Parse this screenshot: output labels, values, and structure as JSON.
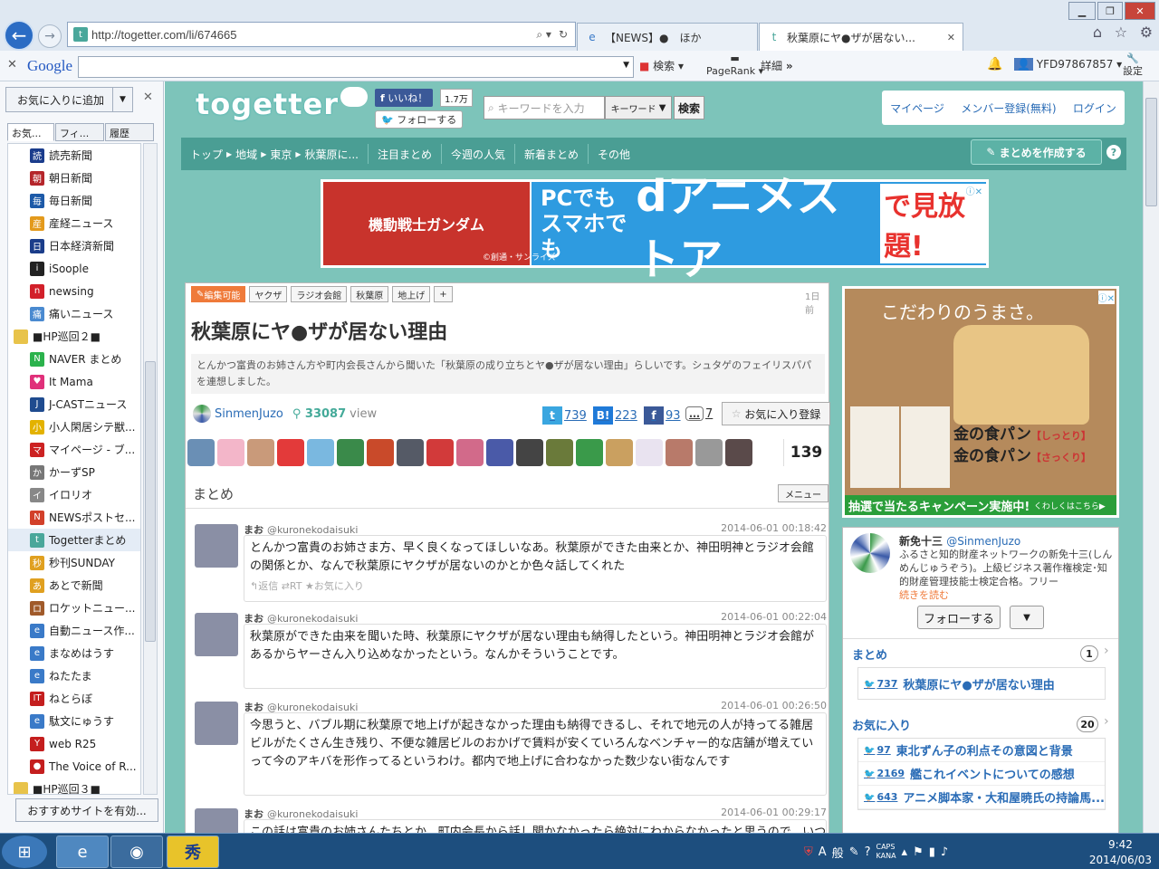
{
  "browser": {
    "url": "http://togetter.com/li/674665",
    "tabs": [
      {
        "label": "【NEWS】●　ほか",
        "active": false
      },
      {
        "label": "秋葉原にヤ●ザが居ない...",
        "active": true
      }
    ]
  },
  "google_bar": {
    "logo": "Google",
    "search": "検索",
    "pagerank": "PageRank",
    "detail": "詳細",
    "more": "»",
    "user": "YFD97867857",
    "settings": "設定"
  },
  "sidebar": {
    "add_favorite": "お気に入りに追加",
    "tabs": [
      "お気...",
      "フィ...",
      "履歴"
    ],
    "items": [
      {
        "label": "読売新聞",
        "color": "#1a3c8c",
        "glyph": "読",
        "type": "link"
      },
      {
        "label": "朝日新聞",
        "color": "#b5262b",
        "glyph": "朝",
        "type": "link"
      },
      {
        "label": "毎日新聞",
        "color": "#1d5aa8",
        "glyph": "毎",
        "type": "link"
      },
      {
        "label": "産経ニュース",
        "color": "#e39a1c",
        "glyph": "産",
        "type": "link"
      },
      {
        "label": "日本経済新聞",
        "color": "#1b3d8a",
        "glyph": "日",
        "type": "link"
      },
      {
        "label": "iSoople",
        "color": "#222222",
        "glyph": "i",
        "type": "link"
      },
      {
        "label": "newsing",
        "color": "#d2202a",
        "glyph": "n",
        "type": "link"
      },
      {
        "label": "痛いニュース",
        "color": "#4a8ad0",
        "glyph": "痛",
        "type": "link"
      },
      {
        "label": "■HP巡回２■",
        "color": "#e8c34a",
        "glyph": "",
        "type": "folder"
      },
      {
        "label": "NAVER まとめ",
        "color": "#2bb24c",
        "glyph": "N",
        "type": "link"
      },
      {
        "label": "It Mama",
        "color": "#e0307a",
        "glyph": "♥",
        "type": "link"
      },
      {
        "label": "J-CASTニュース",
        "color": "#1f4b8f",
        "glyph": "J",
        "type": "link"
      },
      {
        "label": "小人閑居シテ獣...",
        "color": "#e3b200",
        "glyph": "小",
        "type": "link"
      },
      {
        "label": "マイページ - ブ...",
        "color": "#cc2222",
        "glyph": "マ",
        "type": "link"
      },
      {
        "label": "かーずSP",
        "color": "#777777",
        "glyph": "か",
        "type": "link"
      },
      {
        "label": "イロリオ",
        "color": "#888888",
        "glyph": "イ",
        "type": "link"
      },
      {
        "label": "NEWSポストセ...",
        "color": "#d2402a",
        "glyph": "N",
        "type": "link"
      },
      {
        "label": "Togetterまとめ",
        "color": "#4aa79b",
        "glyph": "t",
        "type": "link",
        "selected": true
      },
      {
        "label": "秒刊SUNDAY",
        "color": "#e0a020",
        "glyph": "秒",
        "type": "link"
      },
      {
        "label": "あとで新聞",
        "color": "#e0a020",
        "glyph": "あ",
        "type": "link"
      },
      {
        "label": "ロケットニュー...",
        "color": "#a05a2a",
        "glyph": "ロ",
        "type": "link"
      },
      {
        "label": "自動ニュース作...",
        "color": "#3a7ac8",
        "glyph": "e",
        "type": "link"
      },
      {
        "label": "まなめはうす",
        "color": "#3a7ac8",
        "glyph": "e",
        "type": "link"
      },
      {
        "label": "ねたたま",
        "color": "#3a7ac8",
        "glyph": "e",
        "type": "link"
      },
      {
        "label": "ねとらぼ",
        "color": "#c41e1e",
        "glyph": "IT",
        "type": "link"
      },
      {
        "label": "駄文にゅうす",
        "color": "#3a7ac8",
        "glyph": "e",
        "type": "link"
      },
      {
        "label": "web R25",
        "color": "#c41e1e",
        "glyph": "Y",
        "type": "link"
      },
      {
        "label": "The Voice of R...",
        "color": "#c41e1e",
        "glyph": "●",
        "type": "link"
      },
      {
        "label": "■HP巡回３■",
        "color": "#e8c34a",
        "glyph": "",
        "type": "folder"
      }
    ],
    "recommend": "おすすめサイトを有効..."
  },
  "site": {
    "logo": "togetter",
    "fb_like": "いいね！",
    "fb_count": "1.7万",
    "follow": "フォローする",
    "search_placeholder": "キーワードを入力",
    "search_type": "キーワード",
    "search_btn": "検索",
    "account": [
      "マイページ",
      "メンバー登録(無料)",
      "ログイン"
    ],
    "nav": [
      "トップ",
      "▶",
      "地域",
      "▶",
      "東京",
      "▶",
      "秋葉原に...",
      "注目まとめ",
      "今週の人気",
      "新着まとめ",
      "その他"
    ],
    "create_btn": "まとめを作成する",
    "help": "?"
  },
  "banner": {
    "left": "機動戦士ガンダム",
    "line1": "PCでも",
    "line2": "スマホでも",
    "store": "dアニメストア",
    "tail": "で見放題!",
    "credit": "©創通・サンライズ"
  },
  "article": {
    "tags": [
      "編集可能",
      "ヤクザ",
      "ラジオ会館",
      "秋葉原",
      "地上げ",
      "+"
    ],
    "ago": "1日前",
    "title": "秋葉原にヤ●ザが居ない理由",
    "description": "とんかつ富貴のお姉さん方や町内会長さんから聞いた「秋葉原の成り立ちとヤ●ザが居ない理由」らしいです。シュタゲのフェイリスパパを連想しました。",
    "author": "SinmenJuzo",
    "views": "33087",
    "views_label": "view",
    "twitter_count": "739",
    "hatena_count": "223",
    "facebook_count": "93",
    "comment_count": "7",
    "fav_btn": "お気に入り登録",
    "avatar_colors": [
      "#6a8fb5",
      "#f3b6c9",
      "#c99a7a",
      "#e33a3a",
      "#7ab8e0",
      "#3a8a4a",
      "#c94a2a",
      "#555a66",
      "#d23a3a",
      "#d26a8a",
      "#4a5aa8",
      "#444444",
      "#6a7a3a",
      "#3a9a4a",
      "#caa060",
      "#e9e3f0",
      "#b87a6a",
      "#999999",
      "#5a4a4a"
    ],
    "avatar_count": "139",
    "section": "まとめ",
    "menu": "メニュー",
    "tweets": [
      {
        "name": "まお",
        "handle": "@kuronekodaisuki",
        "time": "2014-06-01 00:18:42",
        "text": "とんかつ富貴のお姉さま方、早く良くなってほしいなあ。秋葉原ができた由来とか、神田明神とラジオ会館の関係とか、なんで秋葉原にヤクザが居ないのかとか色々話してくれた",
        "actions": "↰返信 ⇄RT ★お気に入り"
      },
      {
        "name": "まお",
        "handle": "@kuronekodaisuki",
        "time": "2014-06-01 00:22:04",
        "text": "秋葉原ができた由来を聞いた時、秋葉原にヤクザが居ない理由も納得したという。神田明神とラジオ会館があるからヤーさん入り込めなかったという。なんかそういうことです。",
        "actions": ""
      },
      {
        "name": "まお",
        "handle": "@kuronekodaisuki",
        "time": "2014-06-01 00:26:50",
        "text": "今思うと、バブル期に秋葉原で地上げが起きなかった理由も納得できるし、それで地元の人が持ってる雑居ビルがたくさん生き残り、不便な雑居ビルのおかげで賃料が安くていろんなベンチャー的な店舗が増えていって今のアキバを形作ってるというわけ。都内で地上げに合わなかった数少ない街なんです",
        "actions": ""
      },
      {
        "name": "まお",
        "handle": "@kuronekodaisuki",
        "time": "2014-06-01 00:29:17",
        "text": "この話は富貴のお姉さんたちとか、町内会長から話し聞かなかったら絶対にわからなかったと思うので、いつ",
        "actions": ""
      }
    ]
  },
  "ad2": {
    "headline": "こだわりのうまさ。",
    "product1": "金の食パン",
    "product1_sub": "【しっとり】",
    "product2": "金の食パン",
    "product2_sub": "【さっくり】",
    "campaign": "抽選で当たるキャンペーン実施中!",
    "campaign_more": "くわしくはこちら▶"
  },
  "profile": {
    "name": "新免十三",
    "handle": "@SinmenJuzo",
    "bio": "ふるさと知的財産ネットワークの新免十三(しんめんじゅうぞう)。上級ビジネス著作権検定･知的財産管理技能士検定合格。フリー",
    "more": "続きを読む",
    "follow": "フォローする",
    "matome_label": "まとめ",
    "matome_count": "1",
    "matome_items": [
      {
        "count": "737",
        "title": "秋葉原にヤ●ザが居ない理由"
      }
    ],
    "fav_label": "お気に入り",
    "fav_count": "20",
    "fav_items": [
      {
        "count": "97",
        "title": "東北ずん子の利点その意図と背景"
      },
      {
        "count": "2169",
        "title": "艦これイベントについての感想"
      },
      {
        "count": "643",
        "title": "アニメ脚本家・大和屋暁氏の持論馬..."
      }
    ]
  },
  "taskbar": {
    "ime_a": "A",
    "ime_mode": "般",
    "caps": "CAPS",
    "kana": "KANA",
    "time": "9:42",
    "date": "2014/06/03"
  },
  "colors": {
    "site_bg": "#7dc4ba",
    "nav": "#4a9e94",
    "link": "#2a6cb6",
    "edit_tag": "#ef7a3a"
  }
}
